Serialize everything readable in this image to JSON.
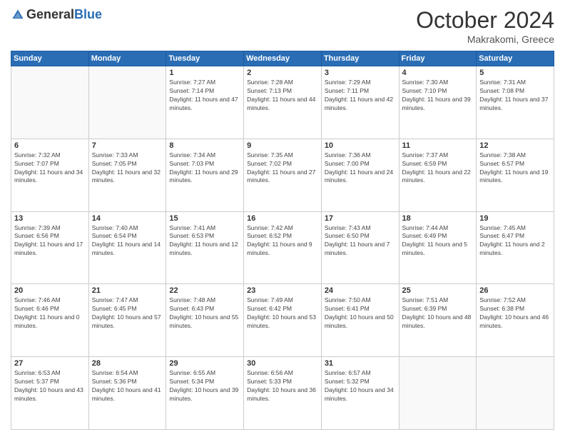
{
  "header": {
    "logo_general": "General",
    "logo_blue": "Blue",
    "month": "October 2024",
    "location": "Makrakomi, Greece"
  },
  "days_of_week": [
    "Sunday",
    "Monday",
    "Tuesday",
    "Wednesday",
    "Thursday",
    "Friday",
    "Saturday"
  ],
  "weeks": [
    [
      {
        "day": "",
        "sunrise": "",
        "sunset": "",
        "daylight": ""
      },
      {
        "day": "",
        "sunrise": "",
        "sunset": "",
        "daylight": ""
      },
      {
        "day": "1",
        "sunrise": "Sunrise: 7:27 AM",
        "sunset": "Sunset: 7:14 PM",
        "daylight": "Daylight: 11 hours and 47 minutes."
      },
      {
        "day": "2",
        "sunrise": "Sunrise: 7:28 AM",
        "sunset": "Sunset: 7:13 PM",
        "daylight": "Daylight: 11 hours and 44 minutes."
      },
      {
        "day": "3",
        "sunrise": "Sunrise: 7:29 AM",
        "sunset": "Sunset: 7:11 PM",
        "daylight": "Daylight: 11 hours and 42 minutes."
      },
      {
        "day": "4",
        "sunrise": "Sunrise: 7:30 AM",
        "sunset": "Sunset: 7:10 PM",
        "daylight": "Daylight: 11 hours and 39 minutes."
      },
      {
        "day": "5",
        "sunrise": "Sunrise: 7:31 AM",
        "sunset": "Sunset: 7:08 PM",
        "daylight": "Daylight: 11 hours and 37 minutes."
      }
    ],
    [
      {
        "day": "6",
        "sunrise": "Sunrise: 7:32 AM",
        "sunset": "Sunset: 7:07 PM",
        "daylight": "Daylight: 11 hours and 34 minutes."
      },
      {
        "day": "7",
        "sunrise": "Sunrise: 7:33 AM",
        "sunset": "Sunset: 7:05 PM",
        "daylight": "Daylight: 11 hours and 32 minutes."
      },
      {
        "day": "8",
        "sunrise": "Sunrise: 7:34 AM",
        "sunset": "Sunset: 7:03 PM",
        "daylight": "Daylight: 11 hours and 29 minutes."
      },
      {
        "day": "9",
        "sunrise": "Sunrise: 7:35 AM",
        "sunset": "Sunset: 7:02 PM",
        "daylight": "Daylight: 11 hours and 27 minutes."
      },
      {
        "day": "10",
        "sunrise": "Sunrise: 7:36 AM",
        "sunset": "Sunset: 7:00 PM",
        "daylight": "Daylight: 11 hours and 24 minutes."
      },
      {
        "day": "11",
        "sunrise": "Sunrise: 7:37 AM",
        "sunset": "Sunset: 6:59 PM",
        "daylight": "Daylight: 11 hours and 22 minutes."
      },
      {
        "day": "12",
        "sunrise": "Sunrise: 7:38 AM",
        "sunset": "Sunset: 6:57 PM",
        "daylight": "Daylight: 11 hours and 19 minutes."
      }
    ],
    [
      {
        "day": "13",
        "sunrise": "Sunrise: 7:39 AM",
        "sunset": "Sunset: 6:56 PM",
        "daylight": "Daylight: 11 hours and 17 minutes."
      },
      {
        "day": "14",
        "sunrise": "Sunrise: 7:40 AM",
        "sunset": "Sunset: 6:54 PM",
        "daylight": "Daylight: 11 hours and 14 minutes."
      },
      {
        "day": "15",
        "sunrise": "Sunrise: 7:41 AM",
        "sunset": "Sunset: 6:53 PM",
        "daylight": "Daylight: 11 hours and 12 minutes."
      },
      {
        "day": "16",
        "sunrise": "Sunrise: 7:42 AM",
        "sunset": "Sunset: 6:52 PM",
        "daylight": "Daylight: 11 hours and 9 minutes."
      },
      {
        "day": "17",
        "sunrise": "Sunrise: 7:43 AM",
        "sunset": "Sunset: 6:50 PM",
        "daylight": "Daylight: 11 hours and 7 minutes."
      },
      {
        "day": "18",
        "sunrise": "Sunrise: 7:44 AM",
        "sunset": "Sunset: 6:49 PM",
        "daylight": "Daylight: 11 hours and 5 minutes."
      },
      {
        "day": "19",
        "sunrise": "Sunrise: 7:45 AM",
        "sunset": "Sunset: 6:47 PM",
        "daylight": "Daylight: 11 hours and 2 minutes."
      }
    ],
    [
      {
        "day": "20",
        "sunrise": "Sunrise: 7:46 AM",
        "sunset": "Sunset: 6:46 PM",
        "daylight": "Daylight: 11 hours and 0 minutes."
      },
      {
        "day": "21",
        "sunrise": "Sunrise: 7:47 AM",
        "sunset": "Sunset: 6:45 PM",
        "daylight": "Daylight: 10 hours and 57 minutes."
      },
      {
        "day": "22",
        "sunrise": "Sunrise: 7:48 AM",
        "sunset": "Sunset: 6:43 PM",
        "daylight": "Daylight: 10 hours and 55 minutes."
      },
      {
        "day": "23",
        "sunrise": "Sunrise: 7:49 AM",
        "sunset": "Sunset: 6:42 PM",
        "daylight": "Daylight: 10 hours and 53 minutes."
      },
      {
        "day": "24",
        "sunrise": "Sunrise: 7:50 AM",
        "sunset": "Sunset: 6:41 PM",
        "daylight": "Daylight: 10 hours and 50 minutes."
      },
      {
        "day": "25",
        "sunrise": "Sunrise: 7:51 AM",
        "sunset": "Sunset: 6:39 PM",
        "daylight": "Daylight: 10 hours and 48 minutes."
      },
      {
        "day": "26",
        "sunrise": "Sunrise: 7:52 AM",
        "sunset": "Sunset: 6:38 PM",
        "daylight": "Daylight: 10 hours and 46 minutes."
      }
    ],
    [
      {
        "day": "27",
        "sunrise": "Sunrise: 6:53 AM",
        "sunset": "Sunset: 5:37 PM",
        "daylight": "Daylight: 10 hours and 43 minutes."
      },
      {
        "day": "28",
        "sunrise": "Sunrise: 6:54 AM",
        "sunset": "Sunset: 5:36 PM",
        "daylight": "Daylight: 10 hours and 41 minutes."
      },
      {
        "day": "29",
        "sunrise": "Sunrise: 6:55 AM",
        "sunset": "Sunset: 5:34 PM",
        "daylight": "Daylight: 10 hours and 39 minutes."
      },
      {
        "day": "30",
        "sunrise": "Sunrise: 6:56 AM",
        "sunset": "Sunset: 5:33 PM",
        "daylight": "Daylight: 10 hours and 36 minutes."
      },
      {
        "day": "31",
        "sunrise": "Sunrise: 6:57 AM",
        "sunset": "Sunset: 5:32 PM",
        "daylight": "Daylight: 10 hours and 34 minutes."
      },
      {
        "day": "",
        "sunrise": "",
        "sunset": "",
        "daylight": ""
      },
      {
        "day": "",
        "sunrise": "",
        "sunset": "",
        "daylight": ""
      }
    ]
  ]
}
